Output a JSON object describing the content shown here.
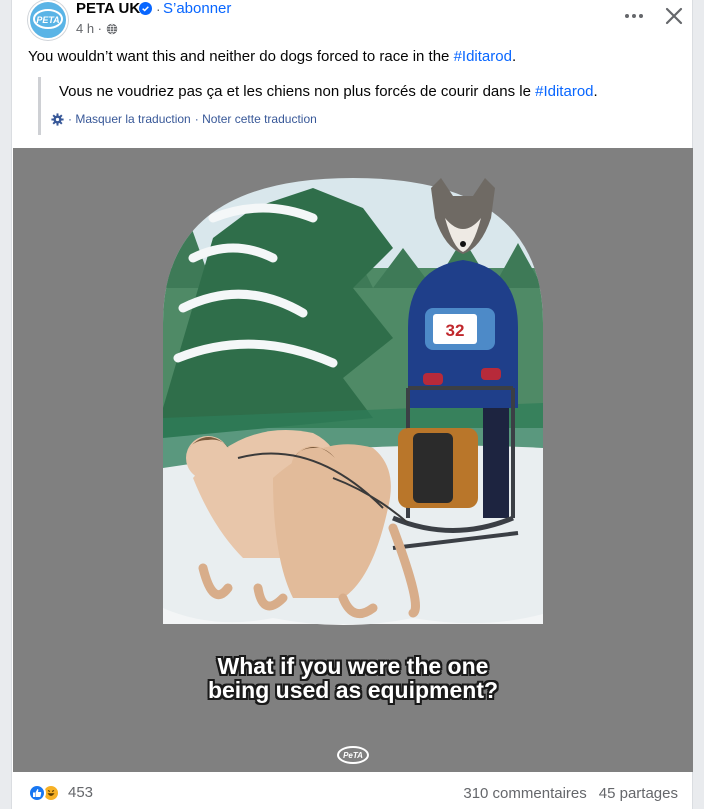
{
  "header": {
    "page_name": "PETA UK",
    "follow_label": "S’abonner",
    "separator": "·",
    "time_label": "4 h ·",
    "avatar_text": "PETA"
  },
  "post": {
    "text_before": "You wouldn’t want this and neither do dogs forced to race in the ",
    "hashtag": "#Iditarod",
    "text_after": "."
  },
  "translation": {
    "text_before": "Vous ne voudriez pas ça et les chiens non plus forcés de courir dans le ",
    "hashtag": "#Iditarod",
    "text_after": ".",
    "hide_label": "· Masquer la traduction",
    "rate_label": "· Noter cette traduction"
  },
  "media": {
    "caption_line1": "What if you were the one",
    "caption_line2": "being used as equipment?",
    "bib_number": "32",
    "logo_text": "PeTA",
    "background_color": "#808080"
  },
  "footer": {
    "reaction_count": "453",
    "comments_label": "310 commentaires",
    "shares_label": "45 partages"
  },
  "icons": {
    "more": "more-options-icon",
    "close": "close-icon",
    "verified": "verified-badge-icon",
    "globe": "globe-icon",
    "gear": "gear-icon",
    "like": "like-reaction-icon",
    "haha": "haha-reaction-icon"
  },
  "colors": {
    "link": "#0866ff",
    "secondary_text": "#65676b",
    "like_blue": "#1877f2",
    "haha_yellow": "#f7b125"
  }
}
